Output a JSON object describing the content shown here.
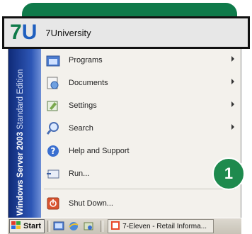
{
  "app_tile": {
    "logo_seven": "7",
    "logo_u": "U",
    "name": "7University"
  },
  "side_band": {
    "product": "Windows Server 2003",
    "edition": "Standard Edition"
  },
  "menu": {
    "programs": "Programs",
    "documents": "Documents",
    "settings": "Settings",
    "search": "Search",
    "help": "Help and Support",
    "run": "Run...",
    "shutdown": "Shut Down..."
  },
  "badge": {
    "number": "1"
  },
  "taskbar": {
    "start_label": "Start",
    "task_label": "7-Eleven - Retail Informa..."
  },
  "colors": {
    "brand_green": "#0f7a4a",
    "band_blue": "#2d56b5"
  }
}
